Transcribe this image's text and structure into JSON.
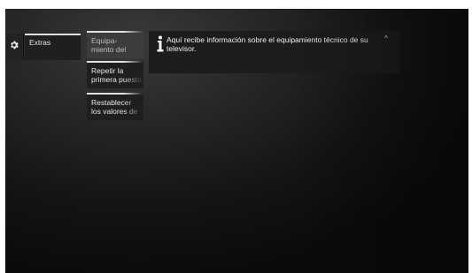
{
  "menu": {
    "root_label": "Extras",
    "items": [
      {
        "label_line1": "Equipa-",
        "label_line2": "miento del",
        "active": true
      },
      {
        "label_line1": "Repetir la",
        "label_line2": "primera puesta",
        "active": false
      },
      {
        "label_line1": "Restablecer",
        "label_line2": "los valores de",
        "active": false
      }
    ]
  },
  "info": {
    "icon": "info-icon",
    "text": "Aquí recibe información sobre el equipamiento técnico de su televisor.",
    "scroll_indicator": "^"
  },
  "icons": {
    "settings": "gear-icon"
  },
  "colors": {
    "tile_background": "#1f1f1f",
    "active_tile_background": "#3c3c3c",
    "text": "#f0f0f0"
  }
}
